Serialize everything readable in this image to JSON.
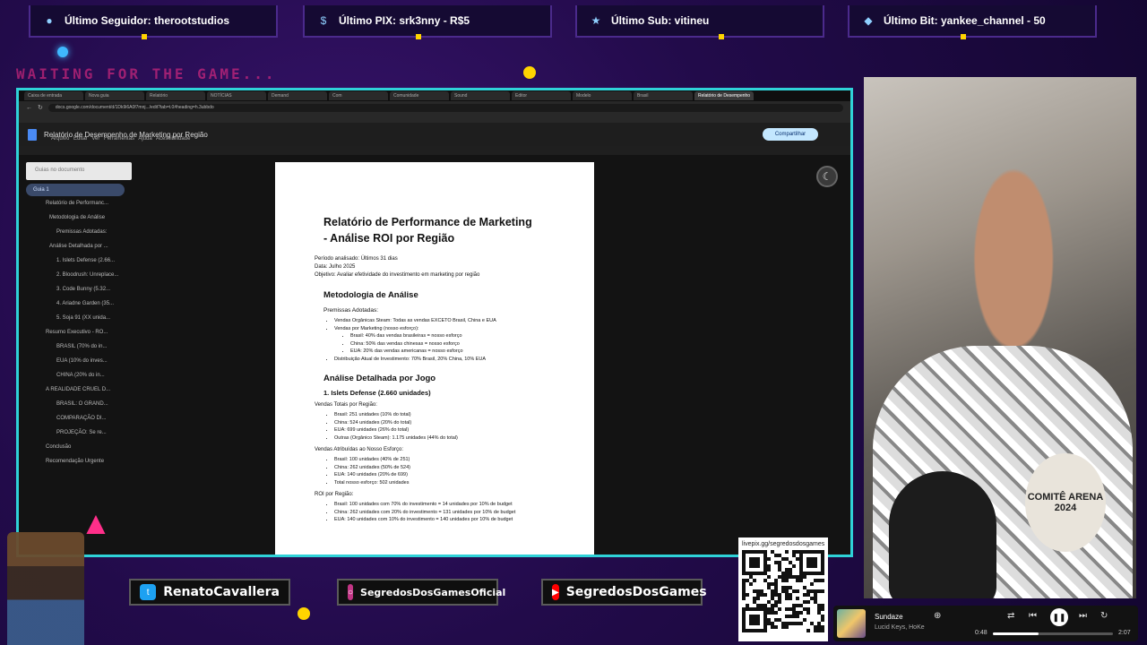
{
  "alerts": [
    {
      "label": "Último Seguidor: therootstudios",
      "icon": "user-icon"
    },
    {
      "label": "Último PIX: srk3nny - R$5",
      "icon": "dollar-icon"
    },
    {
      "label": "Último Sub: vitineu",
      "icon": "star-icon"
    },
    {
      "label": "Último Bit: yankee_channel - 50",
      "icon": "diamond-icon"
    }
  ],
  "waiting_text": "WAITING FOR THE GAME...",
  "browser": {
    "tabs": [
      "Caixa de entrada",
      "Nova guia",
      "Relatório",
      "NOTÍCIAS",
      "Demand",
      "Com",
      "Comunidade",
      "Sound",
      "Editor",
      "Modelo",
      "Brasil",
      "Relatório de Desempenho"
    ],
    "url": "docs.google.com/document/d/1Dk9i6A0f7mnj.../edit?tab=t.0#heading=h.3ubbdo"
  },
  "doc": {
    "title": "Relatório de Desempenho de Marketing por Região",
    "menu": "Arquivo Editar Ver Ferramentas Ajuda Acessibilidade",
    "share": "Compartilhar",
    "outline_search": "Guias no documento",
    "outline_tab": "Guia 1",
    "outline": [
      "Relatório de Performanc...",
      "Metodologia de Análise",
      "Premissas Adotadas:",
      "Análise Detalhada por ...",
      "1. Islets Defense (2.66...",
      "2. Bloodrush: Unreplace...",
      "3. Code Bunny (5.32...",
      "4. Ariadne Garden (35...",
      "5. Soja 91 (XX unida...",
      "Resumo Executivo - RO...",
      "BRASIL (70% do in...",
      "EUA (10% do inves...",
      "CHINA (20% do in...",
      "A REALIDADE CRUEL D...",
      "BRASIL: O GRAND...",
      "COMPARAÇÃO DI...",
      "PROJEÇÃO: Se re...",
      "Conclusão",
      "Recomendação Urgente"
    ],
    "page": {
      "heading_line1": "Relatório de Performance de Marketing",
      "heading_line2": "- Análise ROI por Região",
      "period": "Período analisado: Últimos 31 dias",
      "date": "Data: Julho 2025",
      "objective": "Objetivo: Avaliar efetividade do investimento em marketing por região",
      "h_method": "Metodologia de Análise",
      "h_premises": "Premissas Adotadas:",
      "premises": [
        "Vendas Orgânicas Steam: Todas as vendas EXCETO Brasil, China e EUA",
        "Vendas por Marketing (nosso esforço):",
        "Brasil: 40% das vendas brasileiras = nosso esforço",
        "China: 50% das vendas chinesas = nosso esforço",
        "EUA: 20% das vendas americanas = nosso esforço",
        "Distribuição Atual de Investimento: 70% Brasil, 20% China, 10% EUA"
      ],
      "h_detail": "Análise Detalhada por Jogo",
      "h_game1": "1. Islets Defense (2.660 unidades)",
      "sales_region_label": "Vendas Totais por Região:",
      "sales_region": [
        "Brasil: 251 unidades (10% do total)",
        "China: 524 unidades (20% do total)",
        "EUA: 699 unidades (26% do total)",
        "Outras (Orgânico Steam): 1.175 unidades (44% do total)"
      ],
      "attributed_label": "Vendas Atribuídas ao Nosso Esforço:",
      "attributed": [
        "Brasil: 100 unidades (40% de 251)",
        "China: 262 unidades (50% de 524)",
        "EUA: 140 unidades (20% de 699)",
        "Total nosso esforço: 502 unidades"
      ],
      "roi_label": "ROI por Região:",
      "roi": [
        "Brasil: 100 unidades com 70% do investimento = 14 unidades por 10% de budget",
        "China: 262 unidades com 20% do investimento = 131 unidades por 10% de budget",
        "EUA: 140 unidades com 10% do investimento = 140 unidades por 10% de budget"
      ]
    }
  },
  "socials": [
    {
      "name": "RenatoCavallera",
      "icon": "twitter-icon",
      "color": "#1da1f2"
    },
    {
      "name": "SegredosDosGamesOficial",
      "icon": "instagram-icon",
      "color": "#c13584"
    },
    {
      "name": "SegredosDosGames",
      "icon": "youtube-icon",
      "color": "#ff0000"
    }
  ],
  "qr_label": "livepix.gg/segredosdosgames",
  "player": {
    "song": "Sundaze",
    "artist": "Lucid Keys, HoKe",
    "elapsed": "0:48",
    "total": "2:07",
    "progress": 0.38
  },
  "cam_patch": "COMITÊ ARENA 2024"
}
